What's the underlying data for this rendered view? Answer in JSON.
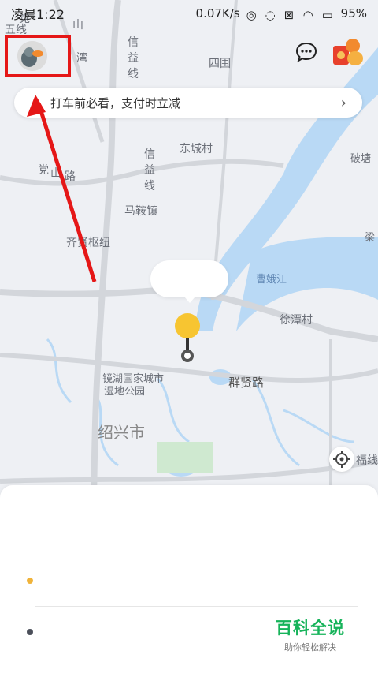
{
  "status": {
    "time": "凌晨1:22",
    "net_speed": "0.07K/s",
    "battery": "95%"
  },
  "banner": {
    "text": "打车前必看，支付时立减",
    "chevron": "›"
  },
  "map_labels": {
    "l1": "五线",
    "l2": "信",
    "l3": "益",
    "l4": "线",
    "l5": "四围",
    "l6": "东城村",
    "l7": "党",
    "l8": "山",
    "l9": "路",
    "l10": "信",
    "l11": "益",
    "l12": "线",
    "l13": "马鞍镇",
    "l14": "齐贤枢纽",
    "l15": "曹娥江",
    "l16": "徐潭村",
    "l17": "镜湖国家城市",
    "l18": "湿地公园",
    "l19": "群贤路",
    "l20": "绍兴市",
    "l21": "破塘",
    "l22": "梁",
    "l23": "福线",
    "l24": "湾",
    "l25": "信",
    "l26": "党",
    "l27": "山"
  },
  "watermark": {
    "title": "百科全说",
    "subtitle": "助你轻松解决"
  },
  "colors": {
    "water": "#b9d9f5",
    "road": "#d3d6db",
    "pin_yellow": "#f7c531",
    "arrow_red": "#e51717"
  }
}
